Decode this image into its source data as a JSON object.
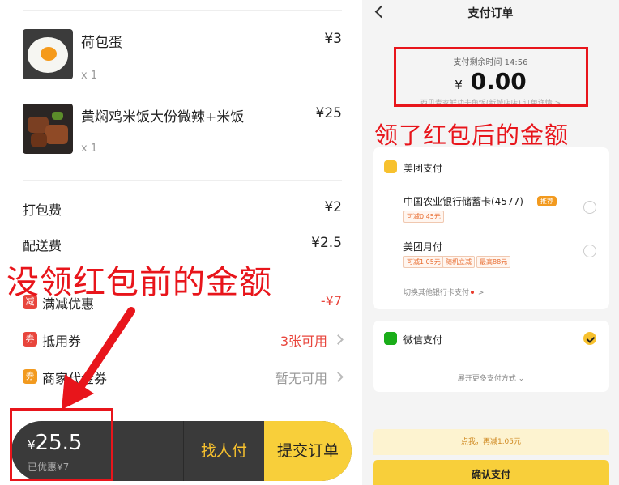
{
  "left": {
    "items": [
      {
        "name": "荷包蛋",
        "qty": "x 1",
        "price": "¥3"
      },
      {
        "name": "黄焖鸡米饭大份微辣+米饭",
        "qty": "x 1",
        "price": "¥25"
      }
    ],
    "fees": [
      {
        "label": "打包费",
        "value": "¥2"
      },
      {
        "label": "配送费",
        "value": "¥2.5"
      }
    ],
    "discount_row": {
      "icon": "减",
      "label": "满减优惠",
      "value": "-¥7"
    },
    "coupon_row": {
      "icon": "券",
      "label": "抵用券",
      "value": "3张可用"
    },
    "merchant_row": {
      "icon": "券",
      "label": "商家代金券",
      "value": "暂无可用"
    },
    "bottom_bar": {
      "currency": "¥",
      "total": "25.5",
      "saved": "已优惠¥7",
      "find_pay": "找人付",
      "submit": "提交订单"
    }
  },
  "right": {
    "title": "支付订单",
    "time_left": "支付剩余时间 14:56",
    "currency": "¥",
    "amount": "0.00",
    "merchant_note": "西贝麦家鲜功夫鱼饭(新城店店)  订单详情 >",
    "meituan_pay": {
      "title": "美团支付",
      "options": [
        {
          "name": "中国农业银行储蓄卡(4577)",
          "badge": "推荐",
          "tags": [
            "可减0.45元"
          ]
        },
        {
          "name": "美团月付",
          "tags": [
            "可减1.05元",
            "随机立减",
            "最高88元"
          ]
        }
      ],
      "switch_bank": "切换其他银行卡支付"
    },
    "wechat_pay": {
      "title": "微信支付",
      "more_ways": "展开更多支付方式"
    },
    "promo": "点我，再减1.05元",
    "confirm": "确认支付"
  },
  "annotations": {
    "before": "没领红包前的金额",
    "after": "领了红包后的金额"
  },
  "colors": {
    "annotation_red": "#e8151b",
    "meituan_yellow": "#f8cf3a",
    "wechat_green": "#1aad19",
    "discount_red": "#e8453c"
  }
}
